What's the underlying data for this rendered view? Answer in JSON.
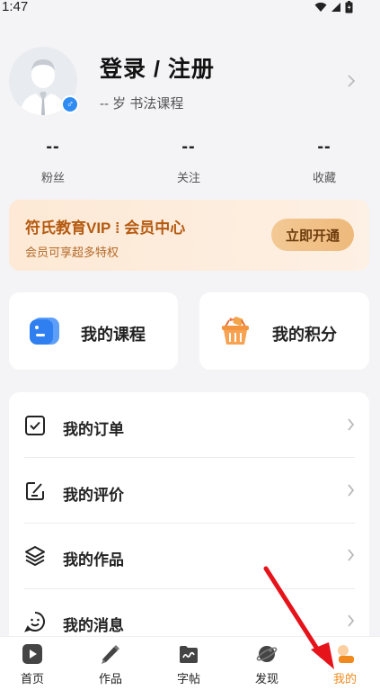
{
  "status_bar": {
    "time": "1:47"
  },
  "profile": {
    "login_title": "登录 / 注册",
    "subtitle": "-- 岁  书法课程",
    "gender_symbol": "♂"
  },
  "stats": [
    {
      "value": "--",
      "label": "粉丝"
    },
    {
      "value": "--",
      "label": "关注"
    },
    {
      "value": "--",
      "label": "收藏"
    }
  ],
  "vip": {
    "title": "符氏教育VIP  ⁞  会员中心",
    "subtitle": "会员可享超多特权",
    "button": "立即开通"
  },
  "cards": [
    {
      "label": "我的课程",
      "icon": "course-icon"
    },
    {
      "label": "我的积分",
      "icon": "points-basket-icon"
    }
  ],
  "menu": [
    {
      "label": "我的订单",
      "icon": "order-check-icon"
    },
    {
      "label": "我的评价",
      "icon": "review-edit-icon"
    },
    {
      "label": "我的作品",
      "icon": "layers-icon"
    },
    {
      "label": "我的消息",
      "icon": "message-smile-icon"
    }
  ],
  "tabs": [
    {
      "label": "首页",
      "icon": "home-play-icon"
    },
    {
      "label": "作品",
      "icon": "brush-icon"
    },
    {
      "label": "字帖",
      "icon": "copybook-icon"
    },
    {
      "label": "发现",
      "icon": "planet-icon"
    },
    {
      "label": "我的",
      "icon": "profile-icon",
      "active": true
    }
  ],
  "colors": {
    "accent": "#f08a1e",
    "vip_text": "#b55a10",
    "badge_blue": "#2f8cf3"
  }
}
